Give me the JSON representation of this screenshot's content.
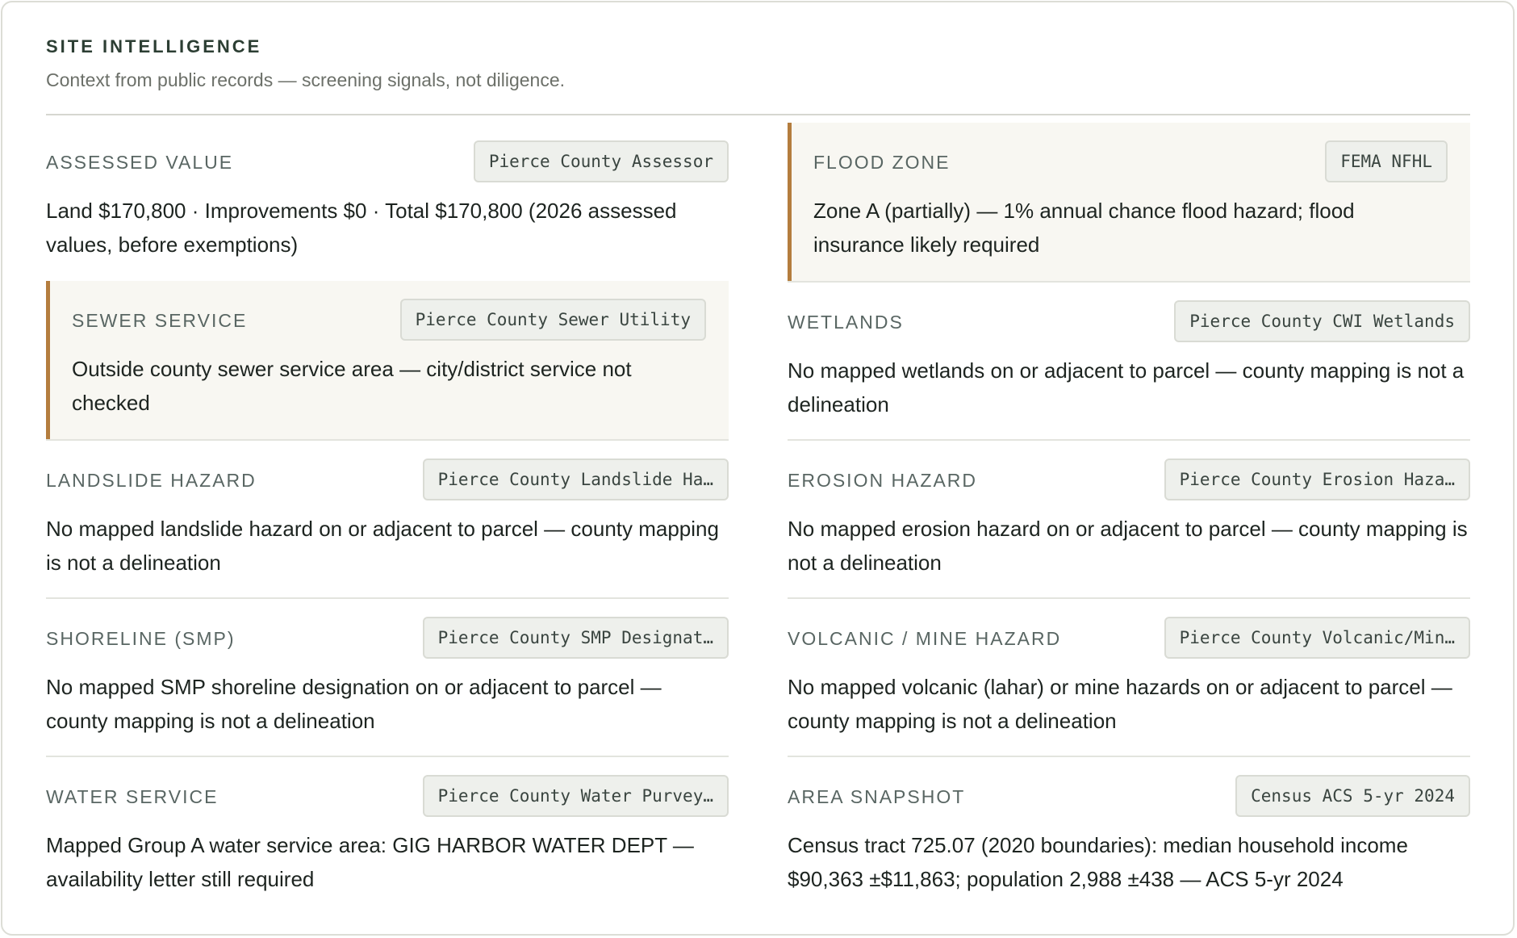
{
  "header": {
    "title": "SITE INTELLIGENCE",
    "subtitle": "Context from public records — screening signals, not diligence."
  },
  "accent_color": "#b47d3e",
  "cards": [
    {
      "label": "ASSESSED VALUE",
      "source": "Pierce County Assessor",
      "value": "Land $170,800 · Improvements $0 · Total $170,800 (2026 assessed values, before exemptions)",
      "flagged": false
    },
    {
      "label": "FLOOD ZONE",
      "source": "FEMA NFHL",
      "value": "Zone A (partially) — 1% annual chance flood hazard; flood insurance likely required",
      "flagged": true
    },
    {
      "label": "SEWER SERVICE",
      "source": "Pierce County Sewer Utility",
      "value": "Outside county sewer service area — city/district service not checked",
      "flagged": true
    },
    {
      "label": "WETLANDS",
      "source": "Pierce County CWI Wetlands",
      "value": "No mapped wetlands on or adjacent to parcel — county mapping is not a delineation",
      "flagged": false
    },
    {
      "label": "LANDSLIDE HAZARD",
      "source": "Pierce County Landslide Ha…",
      "value": "No mapped landslide hazard on or adjacent to parcel — county mapping is not a delineation",
      "flagged": false
    },
    {
      "label": "EROSION HAZARD",
      "source": "Pierce County Erosion Haza…",
      "value": "No mapped erosion hazard on or adjacent to parcel — county mapping is not a delineation",
      "flagged": false
    },
    {
      "label": "SHORELINE (SMP)",
      "source": "Pierce County SMP Designat…",
      "value": "No mapped SMP shoreline designation on or adjacent to parcel — county mapping is not a delineation",
      "flagged": false
    },
    {
      "label": "VOLCANIC / MINE HAZARD",
      "source": "Pierce County Volcanic/Min…",
      "value": "No mapped volcanic (lahar) or mine hazards on or adjacent to parcel — county mapping is not a delineation",
      "flagged": false
    },
    {
      "label": "WATER SERVICE",
      "source": "Pierce County Water Purvey…",
      "value": "Mapped Group A water service area: GIG HARBOR WATER DEPT — availability letter still required",
      "flagged": false
    },
    {
      "label": "AREA SNAPSHOT",
      "source": "Census ACS 5-yr 2024",
      "value": "Census tract 725.07 (2020 boundaries): median household income $90,363 ±$11,863; population 2,988 ±438 — ACS 5-yr 2024",
      "flagged": false
    }
  ]
}
